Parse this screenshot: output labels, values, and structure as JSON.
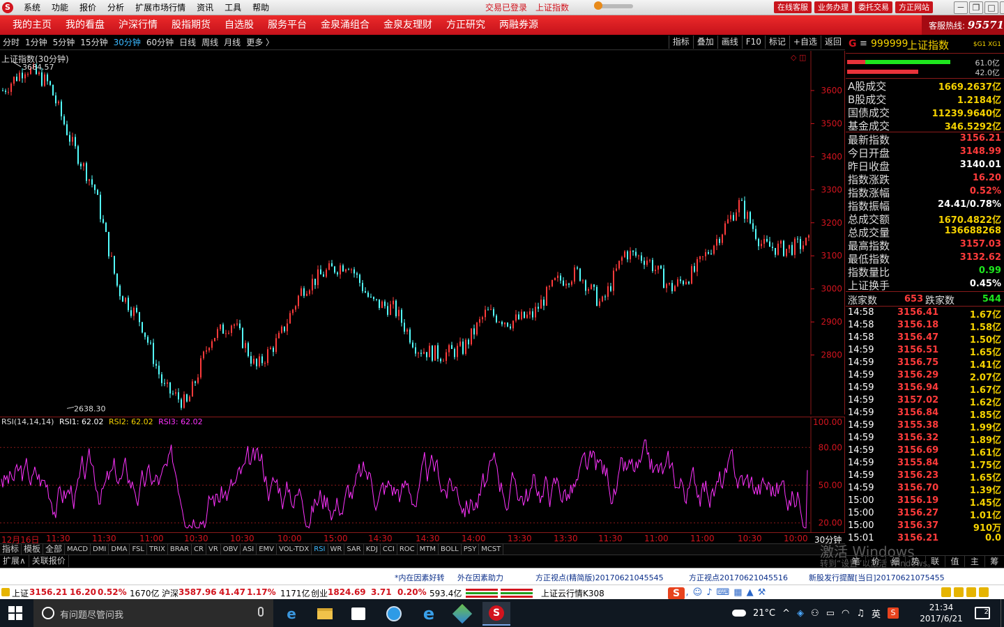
{
  "app": {
    "menu": [
      "系统",
      "功能",
      "报价",
      "分析",
      "扩展市场行情",
      "资讯",
      "工具",
      "帮助"
    ],
    "login_status": "交易已登录",
    "current_index": "上证指数",
    "top_buttons": [
      "在线客服",
      "业务办理",
      "委托交易",
      "方正网站"
    ],
    "window_buttons": [
      "－",
      "❐",
      "□",
      "✕"
    ]
  },
  "nav": {
    "items": [
      "我的主页",
      "我的看盘",
      "沪深行情",
      "股指期货",
      "自选股",
      "服务平台",
      "金泉涌组合",
      "金泉友理财",
      "方正研究",
      "两融券源"
    ],
    "hotline_label": "客服热线:",
    "hotline_number": "95571"
  },
  "periods": {
    "items": [
      "分时",
      "1分钟",
      "5分钟",
      "15分钟",
      "30分钟",
      "60分钟",
      "日线",
      "周线",
      "月线",
      "更多 〉"
    ],
    "active": "30分钟",
    "tools": [
      "指标",
      "叠加",
      "画线",
      "F10",
      "标记",
      "+自选",
      "返回"
    ]
  },
  "main_chart": {
    "title": "上证指数(30分钟)",
    "max_label": "3684.57",
    "min_label": "2638.30",
    "corner_icons": "◇ ◫"
  },
  "rsi_chart": {
    "name": "RSI(14,14,14)",
    "rsi1": "RSI1: 62.02",
    "rsi2": "RSI2: 62.02",
    "rsi3": "RSI3: 62.02"
  },
  "chart_data": [
    {
      "type": "line",
      "chart": "candlestick",
      "title": "上证指数(30分钟)",
      "yticks": [
        3600,
        3500,
        3400,
        3300,
        3200,
        3100,
        3000,
        2900,
        2800
      ],
      "ylim": [
        2620,
        3720
      ],
      "max": 3684.57,
      "min": 2638.3,
      "x_labels": [
        "12月16日",
        "11:30",
        "11:30",
        "11:00",
        "10:30",
        "10:30",
        "10:00",
        "15:00",
        "14:30",
        "14:30",
        "14:00",
        "13:30",
        "13:30",
        "11:30",
        "11:00",
        "11:00",
        "10:30",
        "10:00",
        "30分钟"
      ],
      "x": [
        0,
        10,
        20,
        30,
        40,
        50,
        60,
        70,
        80,
        90,
        100,
        110,
        120,
        130,
        140,
        150,
        160,
        170,
        180,
        190,
        200,
        210,
        220,
        230,
        240,
        250,
        260,
        270,
        280,
        290,
        300,
        310,
        320,
        330,
        340,
        350
      ],
      "values": [
        3600,
        3670,
        3620,
        3440,
        3300,
        3000,
        2900,
        2700,
        2650,
        2850,
        2900,
        2760,
        2850,
        3000,
        3050,
        3080,
        2960,
        2940,
        2820,
        2800,
        2820,
        2930,
        2900,
        2920,
        3020,
        3050,
        2950,
        3110,
        3090,
        3000,
        3050,
        3150,
        3260,
        3130,
        3120,
        3140
      ]
    },
    {
      "type": "line",
      "title": "RSI(14,14,14)",
      "yticks": [
        100,
        80,
        50,
        20
      ],
      "ylim": [
        12,
        104
      ],
      "series": [
        {
          "name": "RSI1",
          "last": 62.02,
          "color": "#ff33ff"
        }
      ]
    }
  ],
  "right_panel": {
    "header": {
      "g": "G",
      "menu": "≡",
      "code": "999999",
      "name": "上证指数",
      "tag": "$G1 XG1"
    },
    "ratio": [
      {
        "value": 61.0,
        "label": "61.0亿",
        "color": "#1ee61e"
      },
      {
        "value": 42.0,
        "label": "42.0亿",
        "color": "#e8333a"
      }
    ],
    "volumes": [
      {
        "k": "A股成交",
        "v": "1669.2637亿"
      },
      {
        "k": "B股成交",
        "v": "1.2184亿"
      },
      {
        "k": "国债成交",
        "v": "11239.9640亿"
      },
      {
        "k": "基金成交",
        "v": "346.5292亿"
      }
    ],
    "stats": [
      {
        "k": "最新指数",
        "v": "3156.21",
        "c": "#ff3b3b"
      },
      {
        "k": "今日开盘",
        "v": "3148.99",
        "c": "#ff3b3b"
      },
      {
        "k": "昨日收盘",
        "v": "3140.01",
        "c": "#ffffff"
      },
      {
        "k": "指数涨跌",
        "v": "16.20",
        "c": "#ff3b3b"
      },
      {
        "k": "指数涨幅",
        "v": "0.52%",
        "c": "#ff3b3b"
      },
      {
        "k": "指数振幅",
        "v": "24.41/0.78%",
        "c": "#ffffff"
      },
      {
        "k": "总成交额",
        "v": "1670.4822亿",
        "c": "#f5d200"
      },
      {
        "k": "总成交量",
        "v": "136688268",
        "c": "#f5d200"
      },
      {
        "k": "最高指数",
        "v": "3157.03",
        "c": "#ff3b3b"
      },
      {
        "k": "最低指数",
        "v": "3132.62",
        "c": "#ff3b3b"
      },
      {
        "k": "指数量比",
        "v": "0.99",
        "c": "#1ee61e"
      },
      {
        "k": "上证换手",
        "v": "0.45%",
        "c": "#ffffff"
      }
    ],
    "updown": {
      "up_label": "涨家数",
      "up": "653",
      "down_label": "跌家数",
      "down": "544"
    },
    "ticks": [
      {
        "t": "14:58",
        "p": "3156.41",
        "v": "1.67亿"
      },
      {
        "t": "14:58",
        "p": "3156.18",
        "v": "1.58亿"
      },
      {
        "t": "14:58",
        "p": "3156.47",
        "v": "1.50亿"
      },
      {
        "t": "14:59",
        "p": "3156.51",
        "v": "1.65亿"
      },
      {
        "t": "14:59",
        "p": "3156.75",
        "v": "1.41亿"
      },
      {
        "t": "14:59",
        "p": "3156.29",
        "v": "2.07亿"
      },
      {
        "t": "14:59",
        "p": "3156.94",
        "v": "1.67亿"
      },
      {
        "t": "14:59",
        "p": "3157.02",
        "v": "1.62亿"
      },
      {
        "t": "14:59",
        "p": "3156.84",
        "v": "1.85亿"
      },
      {
        "t": "14:59",
        "p": "3155.38",
        "v": "1.99亿"
      },
      {
        "t": "14:59",
        "p": "3156.32",
        "v": "1.89亿"
      },
      {
        "t": "14:59",
        "p": "3156.69",
        "v": "1.61亿"
      },
      {
        "t": "14:59",
        "p": "3155.84",
        "v": "1.75亿"
      },
      {
        "t": "14:59",
        "p": "3156.23",
        "v": "1.65亿"
      },
      {
        "t": "14:59",
        "p": "3156.70",
        "v": "1.39亿"
      },
      {
        "t": "15:00",
        "p": "3156.19",
        "v": "1.45亿"
      },
      {
        "t": "15:00",
        "p": "3156.27",
        "v": "1.01亿"
      },
      {
        "t": "15:00",
        "p": "3156.37",
        "v": "910万"
      },
      {
        "t": "15:01",
        "p": "3156.21",
        "v": "0.0"
      }
    ],
    "footer": [
      "笔",
      "价",
      "细",
      "势",
      "联",
      "值",
      "主",
      "筹"
    ],
    "watermark": "激活 Windows",
    "watermark_sub": "转到“设置”以激活 Windows。"
  },
  "indicators": {
    "items": [
      "指标",
      "模板",
      "全部",
      "MACD",
      "DMI",
      "DMA",
      "FSL",
      "TRIX",
      "BRAR",
      "CR",
      "VR",
      "OBV",
      "ASI",
      "EMV",
      "VOL-TDX",
      "RSI",
      "WR",
      "SAR",
      "KDJ",
      "CCI",
      "ROC",
      "MTM",
      "BOLL",
      "PSY",
      "MCST"
    ],
    "active": "RSI",
    "ext": [
      "扩展∧",
      "关联报价"
    ]
  },
  "news": [
    "*内在因素好转",
    "外在因素助力",
    "方正视点(精简版)20170621045545",
    "方正视点20170621045516",
    "新股发行提醒[当日]20170621075455"
  ],
  "market": {
    "sh_label": "上证",
    "sh_value": "3156.21",
    "sh_change": "16.20",
    "sh_pct": "0.52%",
    "sh_amount": "1670亿",
    "hs_label": "沪深",
    "hs_value": "3587.96",
    "hs_change": "41.47",
    "hs_pct": "1.17%",
    "hs_amount": "1171亿",
    "cy_label": "创业",
    "cy_value": "1824.69",
    "cy_change": "3.71",
    "cy_pct": "0.20%",
    "cy_amount": "593.4亿",
    "cloud": "上证云行情K308",
    "ime_lang": "英"
  },
  "taskbar": {
    "search_placeholder": "有问题尽管问我",
    "weather": "21°C",
    "ime": "英",
    "time": "21:34",
    "date": "2017/6/21",
    "notifications": "2"
  }
}
